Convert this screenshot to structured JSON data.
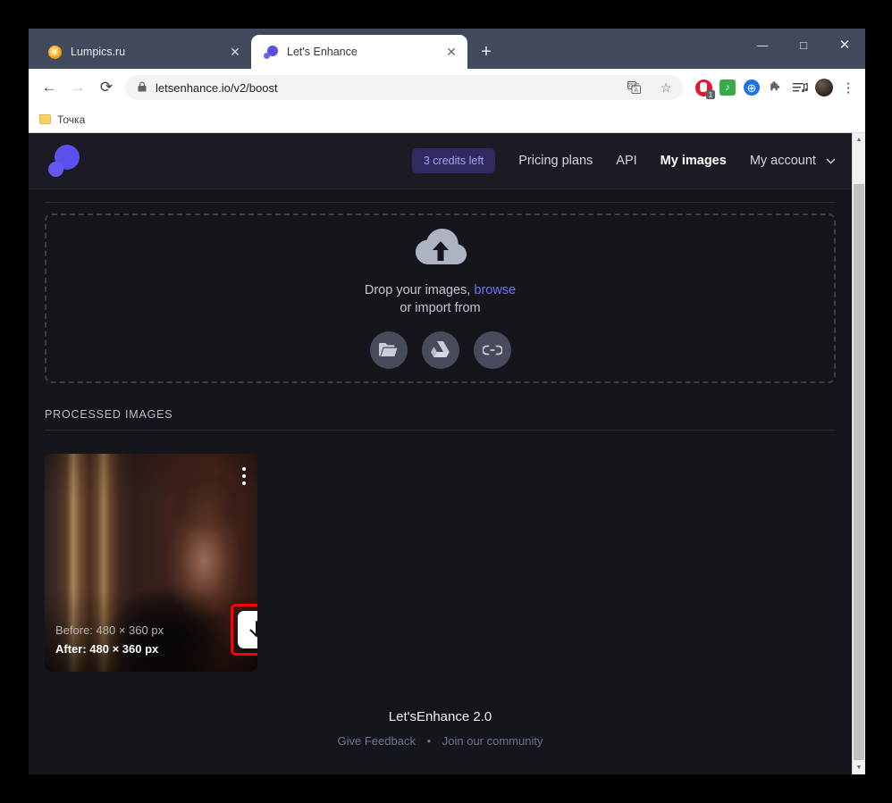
{
  "browser": {
    "tabs": [
      {
        "title": "Lumpics.ru",
        "favicon": "orange-circle-icon",
        "active": false,
        "close_label": "✕"
      },
      {
        "title": "Let's Enhance",
        "favicon": "letsenhance-blob-icon",
        "active": true,
        "close_label": "✕"
      }
    ],
    "new_tab_label": "+",
    "window_controls": {
      "minimize": "—",
      "maximize": "□",
      "close": "✕"
    },
    "toolbar": {
      "back_label": "←",
      "forward_label": "→",
      "reload_label": "⟳",
      "lock_label": "🔒",
      "url": "letsenhance.io/v2/boost",
      "translate_label": "❐",
      "bookmark_star_label": "☆",
      "extension_badge": "1",
      "music_label": "♪",
      "globe_label": "⊕",
      "puzzle_label": "✦",
      "playlist_label": "≡",
      "menu_label": "⋮"
    },
    "bookmarks": [
      {
        "label": "Точка",
        "icon": "folder-icon"
      }
    ]
  },
  "site": {
    "logo_name": "letsenhance-logo",
    "nav": {
      "credits_badge": "3 credits left",
      "links": [
        {
          "label": "Pricing plans",
          "active": false,
          "has_chevron": false
        },
        {
          "label": "API",
          "active": false,
          "has_chevron": false
        },
        {
          "label": "My images",
          "active": true,
          "has_chevron": false
        },
        {
          "label": "My account",
          "active": false,
          "has_chevron": true,
          "chevron": "⌄"
        }
      ]
    },
    "dropzone": {
      "icon": "cloud-upload-icon",
      "line1_prefix": "Drop your images, ",
      "browse_label": "browse",
      "line2": "or import from",
      "import_sources": [
        {
          "name": "folder-icon"
        },
        {
          "name": "google-drive-icon"
        },
        {
          "name": "link-icon"
        }
      ]
    },
    "processed": {
      "section_title": "PROCESSED IMAGES",
      "cards": [
        {
          "before_label": "Before: 480 × 360 px",
          "after_label": "After: 480 × 360 px",
          "menu_icon": "kebab-menu-icon",
          "download_icon": "download-arrow-icon",
          "highlight_color": "#ff0000"
        }
      ]
    },
    "footer": {
      "title": "Let'sEnhance 2.0",
      "feedback_label": "Give Feedback",
      "separator": "•",
      "community_label": "Join our community"
    }
  },
  "colors": {
    "page_bg": "#15161c",
    "header_bg": "#1b1c23",
    "accent_purple": "#6f74f2",
    "badge_bg": "#2f2a60",
    "badge_text": "#a7a2f0",
    "chrome_frame": "#414a5c"
  }
}
